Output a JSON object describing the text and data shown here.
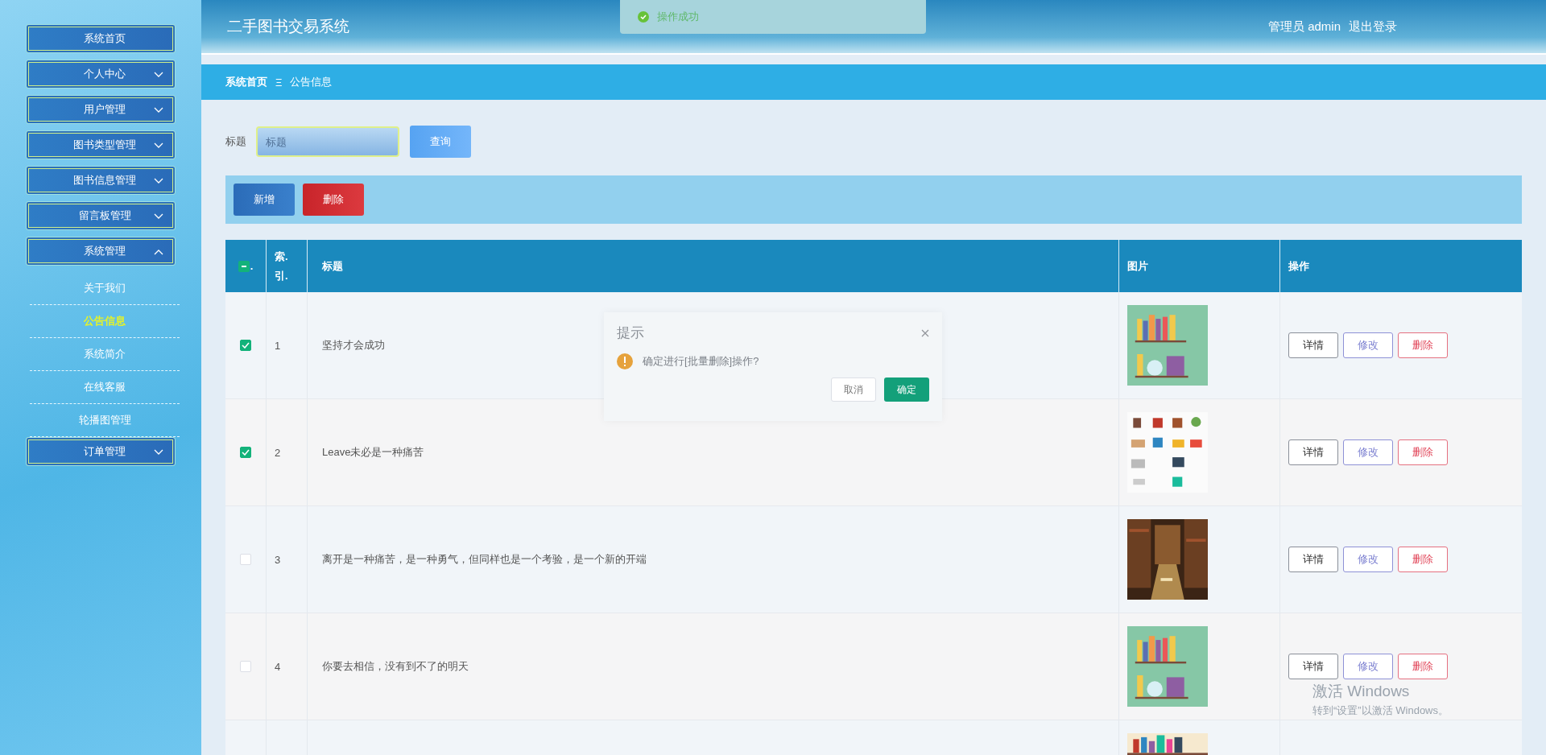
{
  "sidebar": {
    "menu": [
      {
        "label": "系统首页",
        "kind": "link"
      },
      {
        "label": "个人中心",
        "kind": "group",
        "expanded": false
      },
      {
        "label": "用户管理",
        "kind": "group",
        "expanded": false
      },
      {
        "label": "图书类型管理",
        "kind": "group",
        "expanded": false
      },
      {
        "label": "图书信息管理",
        "kind": "group",
        "expanded": false
      },
      {
        "label": "留言板管理",
        "kind": "group",
        "expanded": false
      },
      {
        "label": "系统管理",
        "kind": "group",
        "expanded": true,
        "children": [
          {
            "label": "关于我们",
            "selected": false
          },
          {
            "label": "公告信息",
            "selected": true
          },
          {
            "label": "系统简介",
            "selected": false
          },
          {
            "label": "在线客服",
            "selected": false
          },
          {
            "label": "轮播图管理",
            "selected": false
          }
        ]
      },
      {
        "label": "订单管理",
        "kind": "group",
        "expanded": false
      }
    ]
  },
  "header": {
    "title": "二手图书交易系统",
    "user": "管理员 admin",
    "logout": "退出登录"
  },
  "toast": {
    "message": "操作成功"
  },
  "breadcrumb": {
    "items": [
      "系统首页",
      "公告信息"
    ],
    "separator": "Ξ"
  },
  "search": {
    "label": "标题",
    "placeholder": "标题",
    "button": "查询"
  },
  "actions": [
    {
      "label": "新增",
      "kind": "add"
    },
    {
      "label": "删除",
      "kind": "delete"
    }
  ],
  "table": {
    "select_all": {
      "indeterminate": true,
      "label": "."
    },
    "columns": [
      "索.引.",
      "标题",
      "图片",
      "操作"
    ],
    "rows": [
      {
        "checked": true,
        "index": "1",
        "title": "坚持才会成功",
        "image": {
          "kind": "picture"
        },
        "buttons": [
          {
            "label": "详情",
            "kind": "detail"
          },
          {
            "label": "修改",
            "kind": "edit"
          },
          {
            "label": "删除",
            "kind": "delete"
          }
        ]
      },
      {
        "checked": true,
        "index": "2",
        "title": "Leave未必是一种痛苦",
        "image": {
          "kind": "picture"
        },
        "buttons": [
          {
            "label": "详情",
            "kind": "detail"
          },
          {
            "label": "修改",
            "kind": "edit"
          },
          {
            "label": "删除",
            "kind": "delete"
          }
        ]
      },
      {
        "checked": false,
        "index": "3",
        "title": "离开是一种痛苦，是一种勇气，但同样也是一个考验，是一个新的开端",
        "image": {
          "kind": "picture"
        },
        "buttons": [
          {
            "label": "详情",
            "kind": "detail"
          },
          {
            "label": "修改",
            "kind": "edit"
          },
          {
            "label": "删除",
            "kind": "delete"
          }
        ]
      },
      {
        "checked": false,
        "index": "4",
        "title": "你要去相信，没有到不了的明天",
        "image": {
          "kind": "picture"
        },
        "buttons": [
          {
            "label": "详情",
            "kind": "detail"
          },
          {
            "label": "修改",
            "kind": "edit"
          },
          {
            "label": "删除",
            "kind": "delete"
          }
        ]
      },
      {
        "image": {
          "kind": "picture"
        }
      }
    ]
  },
  "dialog": {
    "title": "提示",
    "message": "确定进行[批量删除]操作?",
    "buttons": [
      {
        "label": "取消",
        "kind": "cancel"
      },
      {
        "label": "确定",
        "kind": "confirm"
      }
    ]
  },
  "os_notice": {
    "title": "激活 Windows",
    "subtitle": "转到“设置”以激活 Windows。"
  }
}
